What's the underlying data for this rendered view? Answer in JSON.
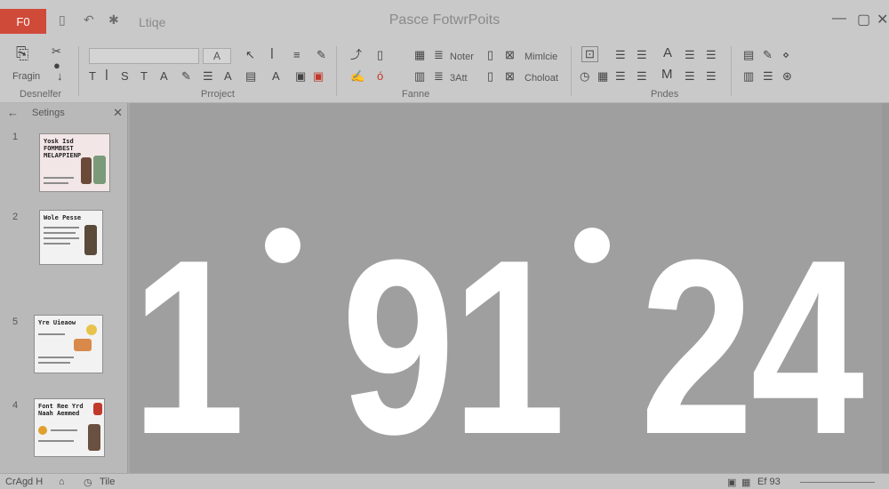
{
  "titlebar": {
    "app_badge": "F0",
    "file_label": "Ltiqe",
    "title": "Pasce FotwrPoits",
    "qa_icons": [
      "save-icon",
      "undo-icon",
      "gear-icon"
    ],
    "win_controls": [
      "minimize-icon",
      "restore-icon",
      "close-icon"
    ]
  },
  "ribbon": {
    "clipboard_label": "Fragin",
    "font_size": "A",
    "groups": [
      "Desnelfer",
      "Prroject",
      "Fanne",
      "Pndes"
    ],
    "format_items": [
      "Noter",
      "3Att",
      "Mimlcie",
      "Choloat"
    ],
    "accent": "#c0392b"
  },
  "pane": {
    "title": "Setings",
    "thumbs": [
      {
        "num": "1",
        "title": "Yosk Isd FOMMBEST MELAPPIENP"
      },
      {
        "num": "2",
        "title": "Wole Pesse"
      },
      {
        "num": "5",
        "title": "Yre Uieaow"
      },
      {
        "num": "4",
        "title": "Font Ree Yrd Naah Aemmed"
      }
    ]
  },
  "slide": {
    "digits": [
      "1",
      "91",
      "24"
    ],
    "separators": [
      "dot",
      "dot"
    ]
  },
  "status": {
    "left_text": "CrAgd H",
    "notes_label": "Tile",
    "zoom_label": "Ef 93"
  }
}
